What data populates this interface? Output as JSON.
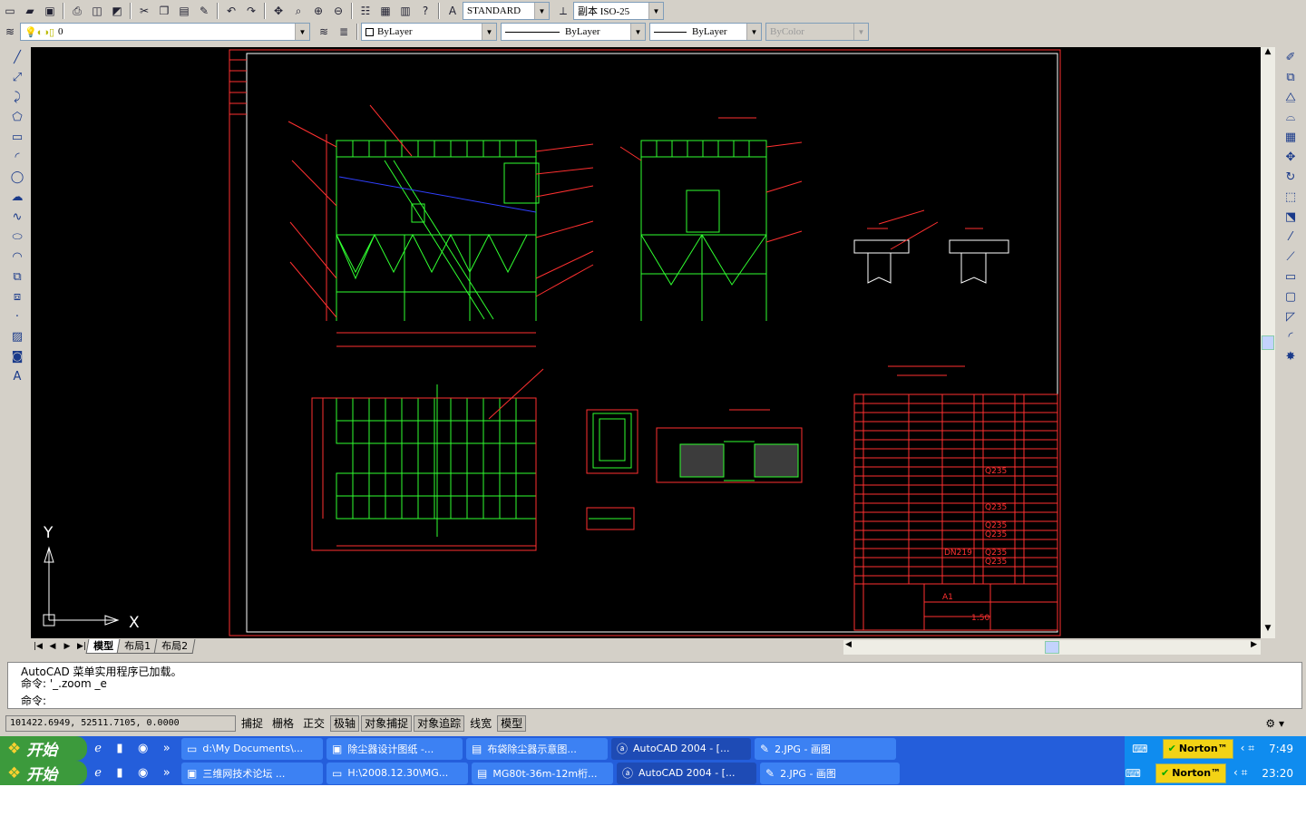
{
  "toolbar1": {
    "text_style": "STANDARD",
    "dim_style": "副本 ISO-25"
  },
  "toolbar2": {
    "layer": "0",
    "color": "ByLayer",
    "linetype": "ByLayer",
    "lineweight": "ByLayer",
    "plotstyle": "ByColor"
  },
  "drawing": {
    "ucs_y": "Y",
    "ucs_x": "X",
    "table_materials": [
      "Q235",
      "Q235",
      "Q235",
      "Q235",
      "Q235",
      "Q235"
    ],
    "pipe_label": "DN219",
    "scale": "1:50",
    "sheet": "A1"
  },
  "layout_tabs": [
    "模型",
    "布局1",
    "布局2"
  ],
  "command": {
    "line1": "AutoCAD 菜单实用程序已加载。",
    "line2": "命令: '_.zoom _e",
    "prompt": "命令:"
  },
  "status": {
    "coords": "101422.6949, 52511.7105, 0.0000",
    "toggles": [
      "捕捉",
      "栅格",
      "正交",
      "极轴",
      "对象捕捉",
      "对象追踪",
      "线宽",
      "模型"
    ]
  },
  "taskbar1": {
    "start": "开始",
    "tasks": [
      "d:\\My Documents\\...",
      "除尘器设计图纸 -...",
      "布袋除尘器示意图...",
      "AutoCAD 2004 - [...",
      "2.JPG - 画图"
    ],
    "norton": "Norton™",
    "time": "7:49"
  },
  "taskbar2": {
    "start": "开始",
    "tasks": [
      "三维网技术论坛 ...",
      "H:\\2008.12.30\\MG...",
      "MG80t-36m-12m桁...",
      "AutoCAD 2004 - [...",
      "2.JPG - 画图"
    ],
    "norton": "Norton™",
    "time": "23:20"
  },
  "colors": {
    "canvas": "#000000",
    "frame": "#ff3030",
    "geometry": "#30ff30",
    "taskbar": "#245edb"
  }
}
